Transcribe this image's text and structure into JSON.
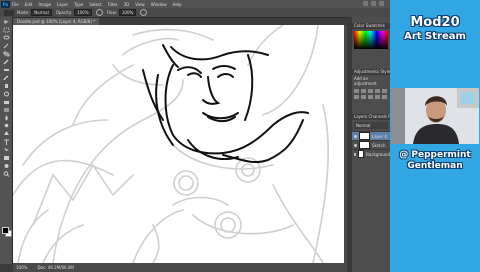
{
  "app": {
    "logo": "Ps",
    "menu": [
      "File",
      "Edit",
      "Image",
      "Layer",
      "Type",
      "Select",
      "Filter",
      "3D",
      "View",
      "Window",
      "Help"
    ]
  },
  "options_bar": {
    "mode_label": "Mode:",
    "mode_value": "Normal",
    "opacity_label": "Opacity:",
    "opacity_value": "100%",
    "flow_label": "Flow:",
    "flow_value": "100%"
  },
  "document": {
    "tab_title": "Doodle.psd @ 100% (Layer 4, RGB/8) *"
  },
  "status": {
    "zoom": "100%",
    "doc_size": "Doc: 46.2M/66.0M"
  },
  "panels": {
    "color_header": "Color   Swatches",
    "adjustments_header": "Adjustments   Styles",
    "adjustments_hint": "Add an adjustment",
    "layers_header": "Layers   Channels   Paths",
    "blend_mode": "Normal",
    "layers": [
      {
        "name": "Layer 4"
      },
      {
        "name": "Sketch"
      },
      {
        "name": "Background"
      }
    ]
  },
  "overlay": {
    "title": "Mod20",
    "subtitle": "Art Stream",
    "handle_line1": "@ Peppermint",
    "handle_line2": "Gentleman",
    "colors": {
      "background": "#32a7e3",
      "outline": "#0b3c6e"
    }
  },
  "icons": [
    "ps-logo-icon",
    "brush-tool-icon",
    "move-tool-icon",
    "marquee-tool-icon",
    "lasso-tool-icon",
    "eye-icon",
    "layer-thumbnail"
  ]
}
